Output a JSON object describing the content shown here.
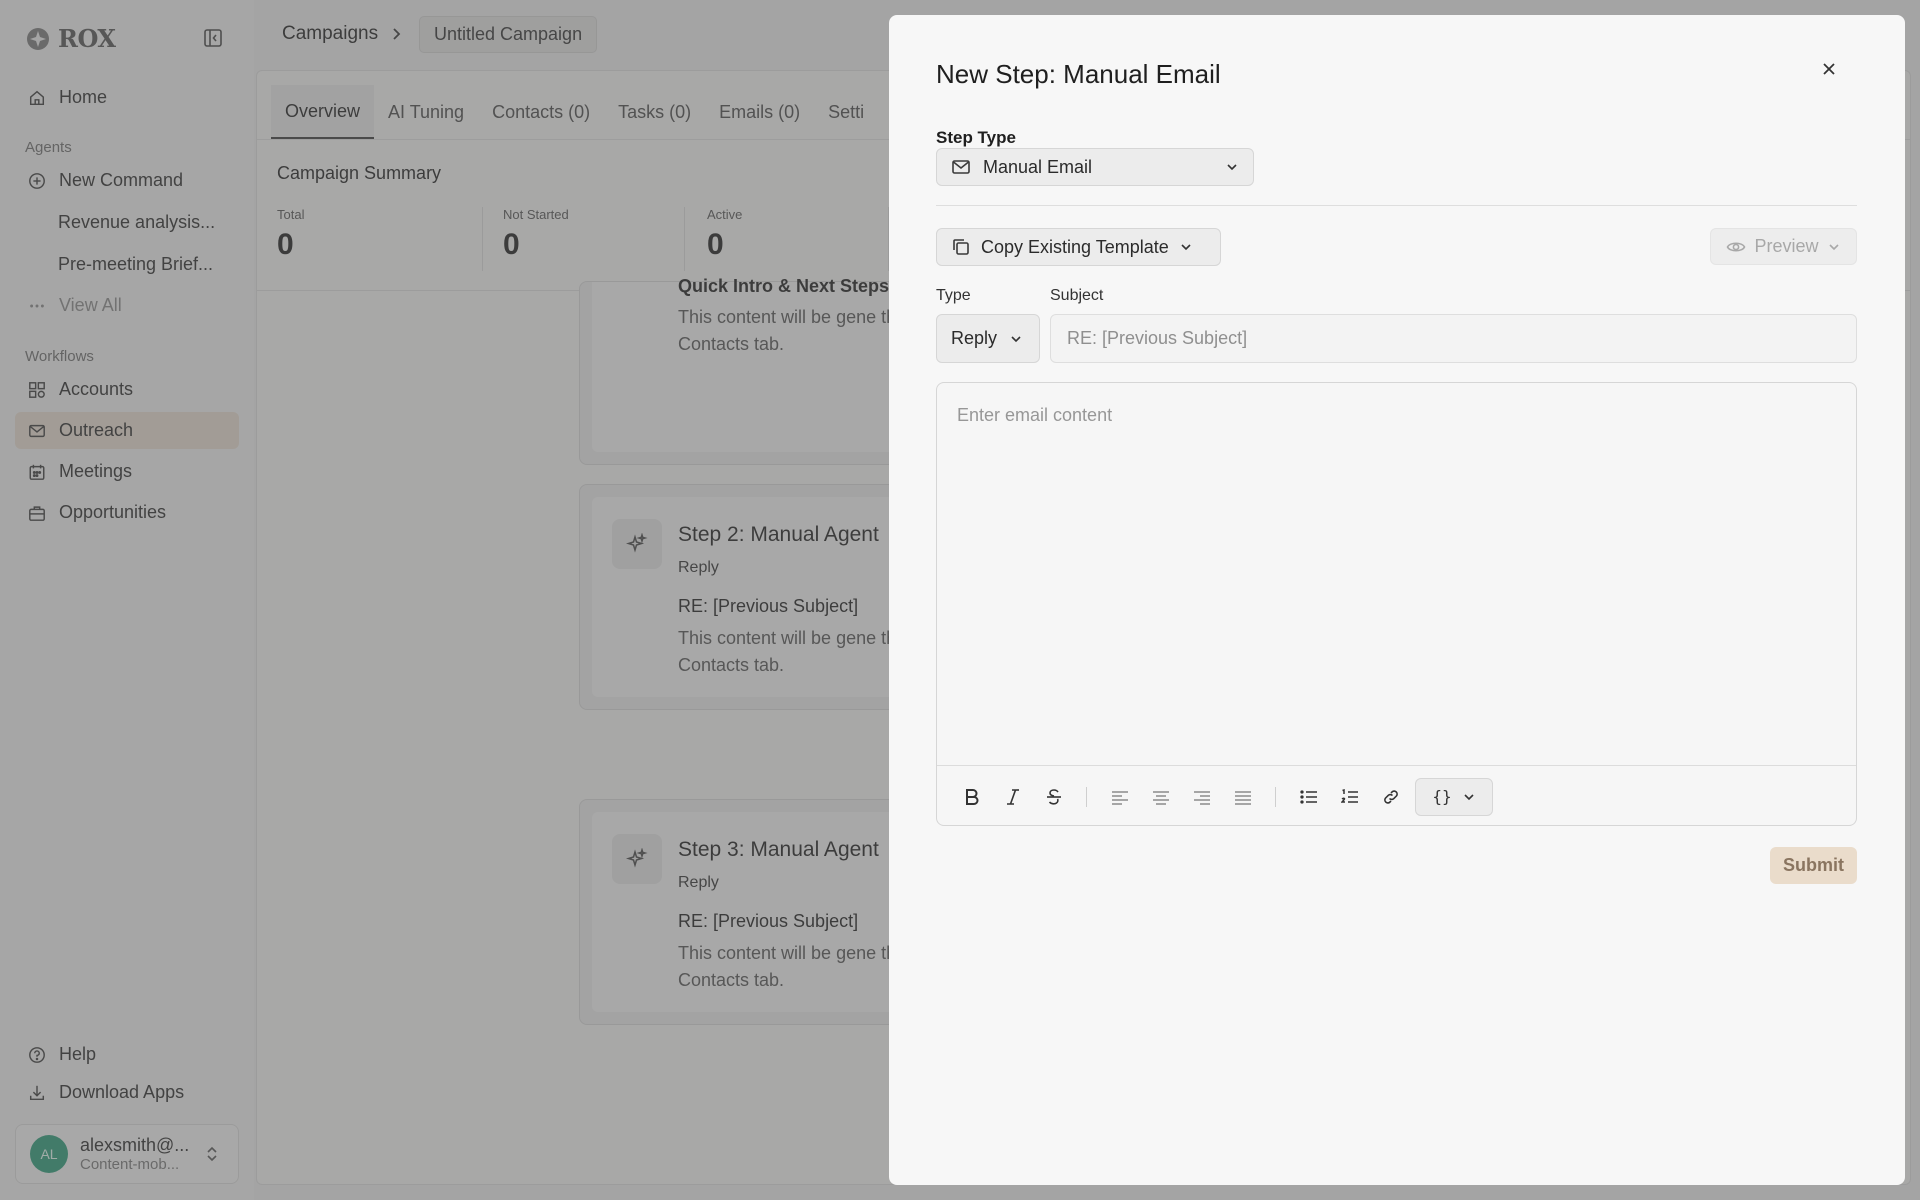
{
  "sidebar": {
    "logo": "ROX",
    "nav": {
      "home": "Home",
      "agents_section": "Agents",
      "new_command": "New Command",
      "recent_1": "Revenue analysis...",
      "recent_2": "Pre-meeting Brief...",
      "view_all": "View All",
      "workflows_section": "Workflows",
      "accounts": "Accounts",
      "outreach": "Outreach",
      "meetings": "Meetings",
      "opportunities": "Opportunities",
      "help": "Help",
      "download_apps": "Download Apps"
    },
    "user": {
      "initials": "AL",
      "email": "alexsmith@...",
      "org": "Content-mob..."
    }
  },
  "breadcrumb": {
    "parent": "Campaigns",
    "current": "Untitled Campaign"
  },
  "tabs": [
    "Overview",
    "AI Tuning",
    "Contacts (0)",
    "Tasks (0)",
    "Emails (0)",
    "Setti"
  ],
  "summary": {
    "title": "Campaign Summary",
    "stats": [
      {
        "label": "Total",
        "value": "0"
      },
      {
        "label": "Not Started",
        "value": "0"
      },
      {
        "label": "Active",
        "value": "0"
      }
    ]
  },
  "steps": {
    "top": {
      "title": "Quick Intro & Next Steps",
      "body": "This content will be gene the Contacts tab."
    },
    "step2": {
      "title": "Step 2: Manual Agent",
      "type": "Reply",
      "subject": "RE: [Previous Subject]",
      "body": "This content will be gene the Contacts tab."
    },
    "step3": {
      "title": "Step 3: Manual Agent",
      "type": "Reply",
      "subject": "RE: [Previous Subject]",
      "body": "This content will be gene the Contacts tab."
    }
  },
  "modal": {
    "title": "New Step: Manual Email",
    "step_type_label": "Step Type",
    "step_type_value": "Manual Email",
    "copy_template": "Copy Existing Template",
    "preview": "Preview",
    "type_label": "Type",
    "type_value": "Reply",
    "subject_label": "Subject",
    "subject_placeholder": "RE: [Previous Subject]",
    "content_placeholder": "Enter email content",
    "variables_button": "{}",
    "submit": "Submit"
  },
  "colors": {
    "accent_active_nav": "#eadfd2",
    "submit_bg": "#eadccb",
    "avatar": "#2a9d79"
  }
}
